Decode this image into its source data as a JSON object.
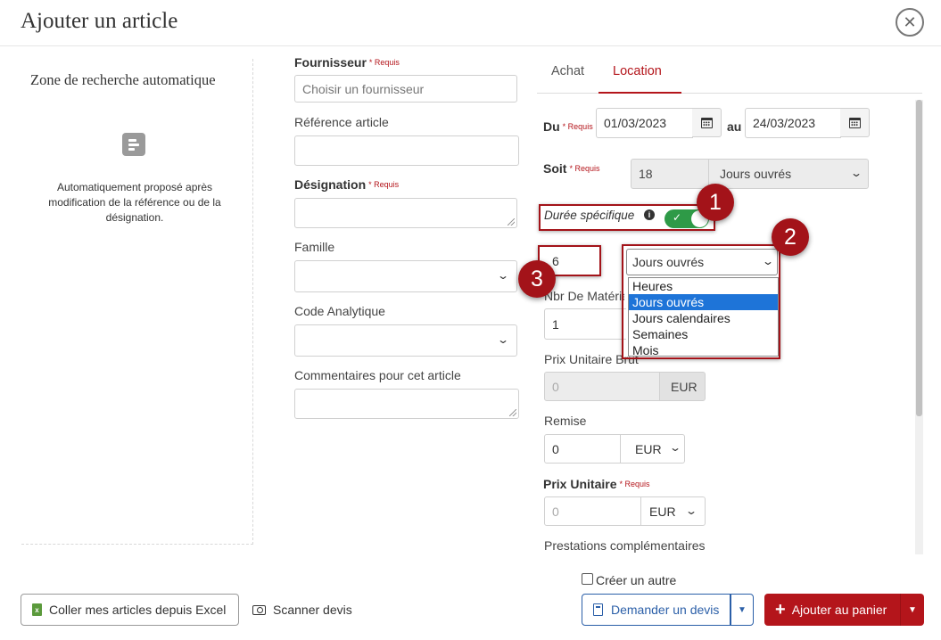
{
  "dialog": {
    "title": "Ajouter un article",
    "close_glyph": "✕"
  },
  "auto_search": {
    "title": "Zone de recherche automatique",
    "description": "Automatiquement proposé après modification de la référence ou de la désignation."
  },
  "form": {
    "required_tag": "* Requis",
    "fournisseur": {
      "label": "Fournisseur",
      "placeholder": "Choisir un fournisseur"
    },
    "reference": {
      "label": "Référence article",
      "value": ""
    },
    "designation": {
      "label": "Désignation",
      "value": ""
    },
    "famille": {
      "label": "Famille",
      "value": ""
    },
    "code_analytique": {
      "label": "Code Analytique",
      "value": ""
    },
    "commentaires": {
      "label": "Commentaires pour cet article",
      "value": ""
    }
  },
  "tabs": [
    {
      "label": "Achat",
      "active": false
    },
    {
      "label": "Location",
      "active": true
    }
  ],
  "location": {
    "du_label": "Du",
    "du_value": "01/03/2023",
    "au_label": "au",
    "au_value": "24/03/2023",
    "soit_label": "Soit",
    "soit_value": "18",
    "soit_unit": "Jours ouvrés",
    "duree_label": "Durée spécifique",
    "duree_enabled": true,
    "duree_value": "6",
    "duree_unit": "Jours ouvrés",
    "unit_options": [
      "Heures",
      "Jours ouvrés",
      "Jours calendaires",
      "Semaines",
      "Mois"
    ],
    "unit_selected_index": 1,
    "nbr_label": "Nbr De Matériel",
    "nbr_value": "1",
    "prix_brut_label": "Prix Unitaire Brut",
    "prix_brut_value": "0",
    "currency": "EUR",
    "remise_label": "Remise",
    "remise_value": "0",
    "remise_unit": "EUR",
    "prix_unitaire_label": "Prix Unitaire",
    "prix_unitaire_value": "0",
    "prix_unitaire_currency": "EUR",
    "prestations_label": "Prestations complémentaires"
  },
  "annotations": {
    "one": "1",
    "two": "2",
    "three": "3"
  },
  "footer": {
    "excel_label": "Coller mes articles depuis Excel",
    "scan_label": "Scanner devis",
    "creer_label": "Créer un autre",
    "devis_label": "Demander un devis",
    "add_label": "Ajouter au panier"
  },
  "colors": {
    "accent": "#b4151b",
    "blue": "#2b5fa8",
    "toggle": "#2e9a47"
  }
}
